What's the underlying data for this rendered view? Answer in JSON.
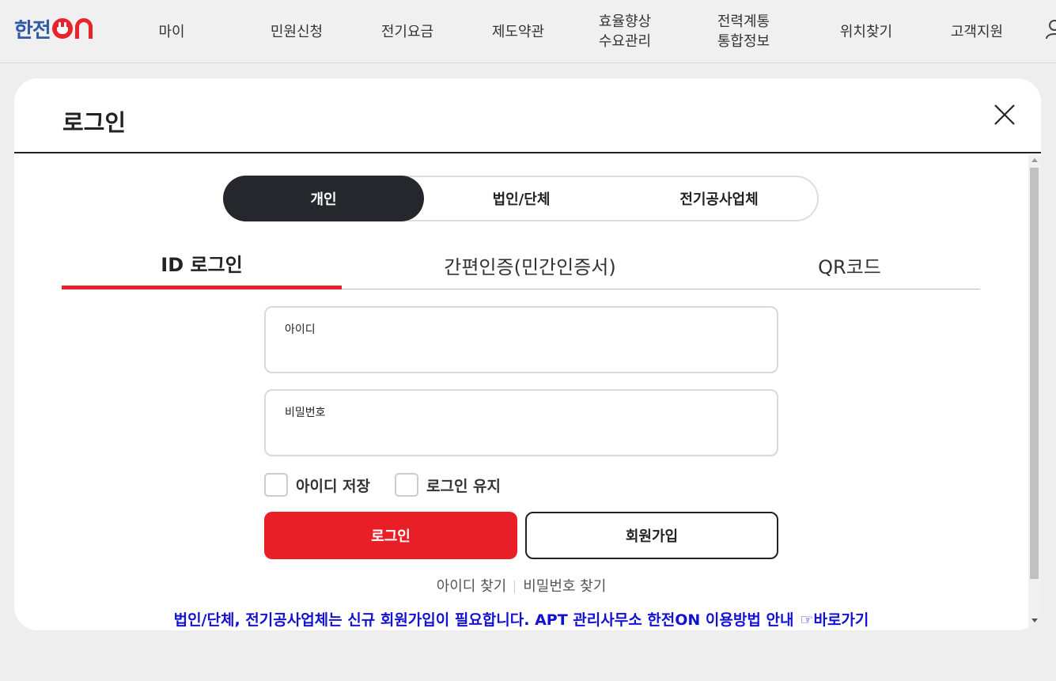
{
  "header": {
    "logo_text": "한전",
    "logo_on_text": "ON",
    "nav": [
      {
        "label": "마이"
      },
      {
        "label": "민원신청"
      },
      {
        "label": "전기요금"
      },
      {
        "label": "제도약관"
      },
      {
        "label": "효율향상\n수요관리"
      },
      {
        "label": "전력계통\n통합정보"
      },
      {
        "label": "위치찾기"
      },
      {
        "label": "고객지원"
      }
    ]
  },
  "modal": {
    "title": "로그인",
    "user_types": [
      "개인",
      "법인/단체",
      "전기공사업체"
    ],
    "active_user_type": "개인",
    "login_tabs": [
      "ID 로그인",
      "간편인증(민간인증서)",
      "QR코드"
    ],
    "active_login_tab": "ID 로그인",
    "id_field": {
      "label": "아이디",
      "value": ""
    },
    "pw_field": {
      "label": "비밀번호",
      "value": ""
    },
    "checkboxes": {
      "save_id": "아이디 저장",
      "keep_login": "로그인 유지"
    },
    "login_button": "로그인",
    "join_button": "회원가입",
    "find_id": "아이디 찾기",
    "find_pw": "비밀번호 찾기",
    "notice_text": "법인/단체, 전기공사업체는 신규 회원가입이 필요합니다. APT 관리사무소 한전ON 이용방법 안내",
    "notice_link": "☞바로가기"
  },
  "colors": {
    "brand_blue": "#2f5aa8",
    "brand_red": "#e8232b",
    "login_button": "#e81f26",
    "active_segment": "#25272c",
    "notice_text": "#1212d0"
  }
}
